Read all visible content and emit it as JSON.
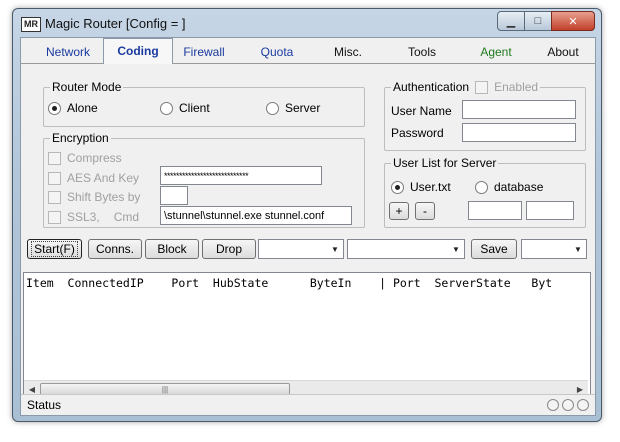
{
  "window": {
    "icon_text": "MR",
    "title": "Magic Router [Config = ]",
    "min_icon": "minimize-icon",
    "max_icon": "maximize-icon",
    "close_icon": "close-icon"
  },
  "tabs": [
    {
      "label": "Network"
    },
    {
      "label": "Coding"
    },
    {
      "label": "Firewall"
    },
    {
      "label": "Quota"
    },
    {
      "label": "Misc."
    },
    {
      "label": "Tools"
    },
    {
      "label": "Agent"
    },
    {
      "label": "About"
    }
  ],
  "router_mode": {
    "legend": "Router Mode",
    "options": [
      {
        "label": "Alone",
        "selected": true
      },
      {
        "label": "Client",
        "selected": false
      },
      {
        "label": "Server",
        "selected": false
      }
    ]
  },
  "authentication": {
    "legend": "Authentication",
    "enabled_label": "Enabled",
    "user_name_label": "User Name",
    "user_name_value": "",
    "password_label": "Password",
    "password_value": ""
  },
  "encryption": {
    "legend": "Encryption",
    "compress_label": "Compress",
    "aes_label": "AES And Key",
    "aes_value": "****************************",
    "shift_label": "Shift Bytes by",
    "shift_value": "",
    "ssl_label": "SSL3,",
    "cmd_label": "Cmd",
    "cmd_value": "\\stunnel\\stunnel.exe stunnel.conf"
  },
  "user_list": {
    "legend": "User List for Server",
    "options": [
      {
        "label": "User.txt",
        "selected": true
      },
      {
        "label": "database",
        "selected": false
      }
    ],
    "plus_label": "+",
    "minus_label": "-",
    "field1_value": "",
    "field2_value": ""
  },
  "toolbar": {
    "start_label": "Start(F)",
    "conns_label": "Conns.",
    "block_label": "Block",
    "drop_label": "Drop",
    "combo1_value": "",
    "combo2_value": "",
    "save_label": "Save",
    "combo3_value": ""
  },
  "listview": {
    "header": "Item  ConnectedIP    Port  HubState      ByteIn    | Port  ServerState   Byt"
  },
  "status": {
    "text": "Status"
  },
  "colors": {
    "tab_blue": "#1a3aa0",
    "tab_green": "#1f7a1f"
  }
}
